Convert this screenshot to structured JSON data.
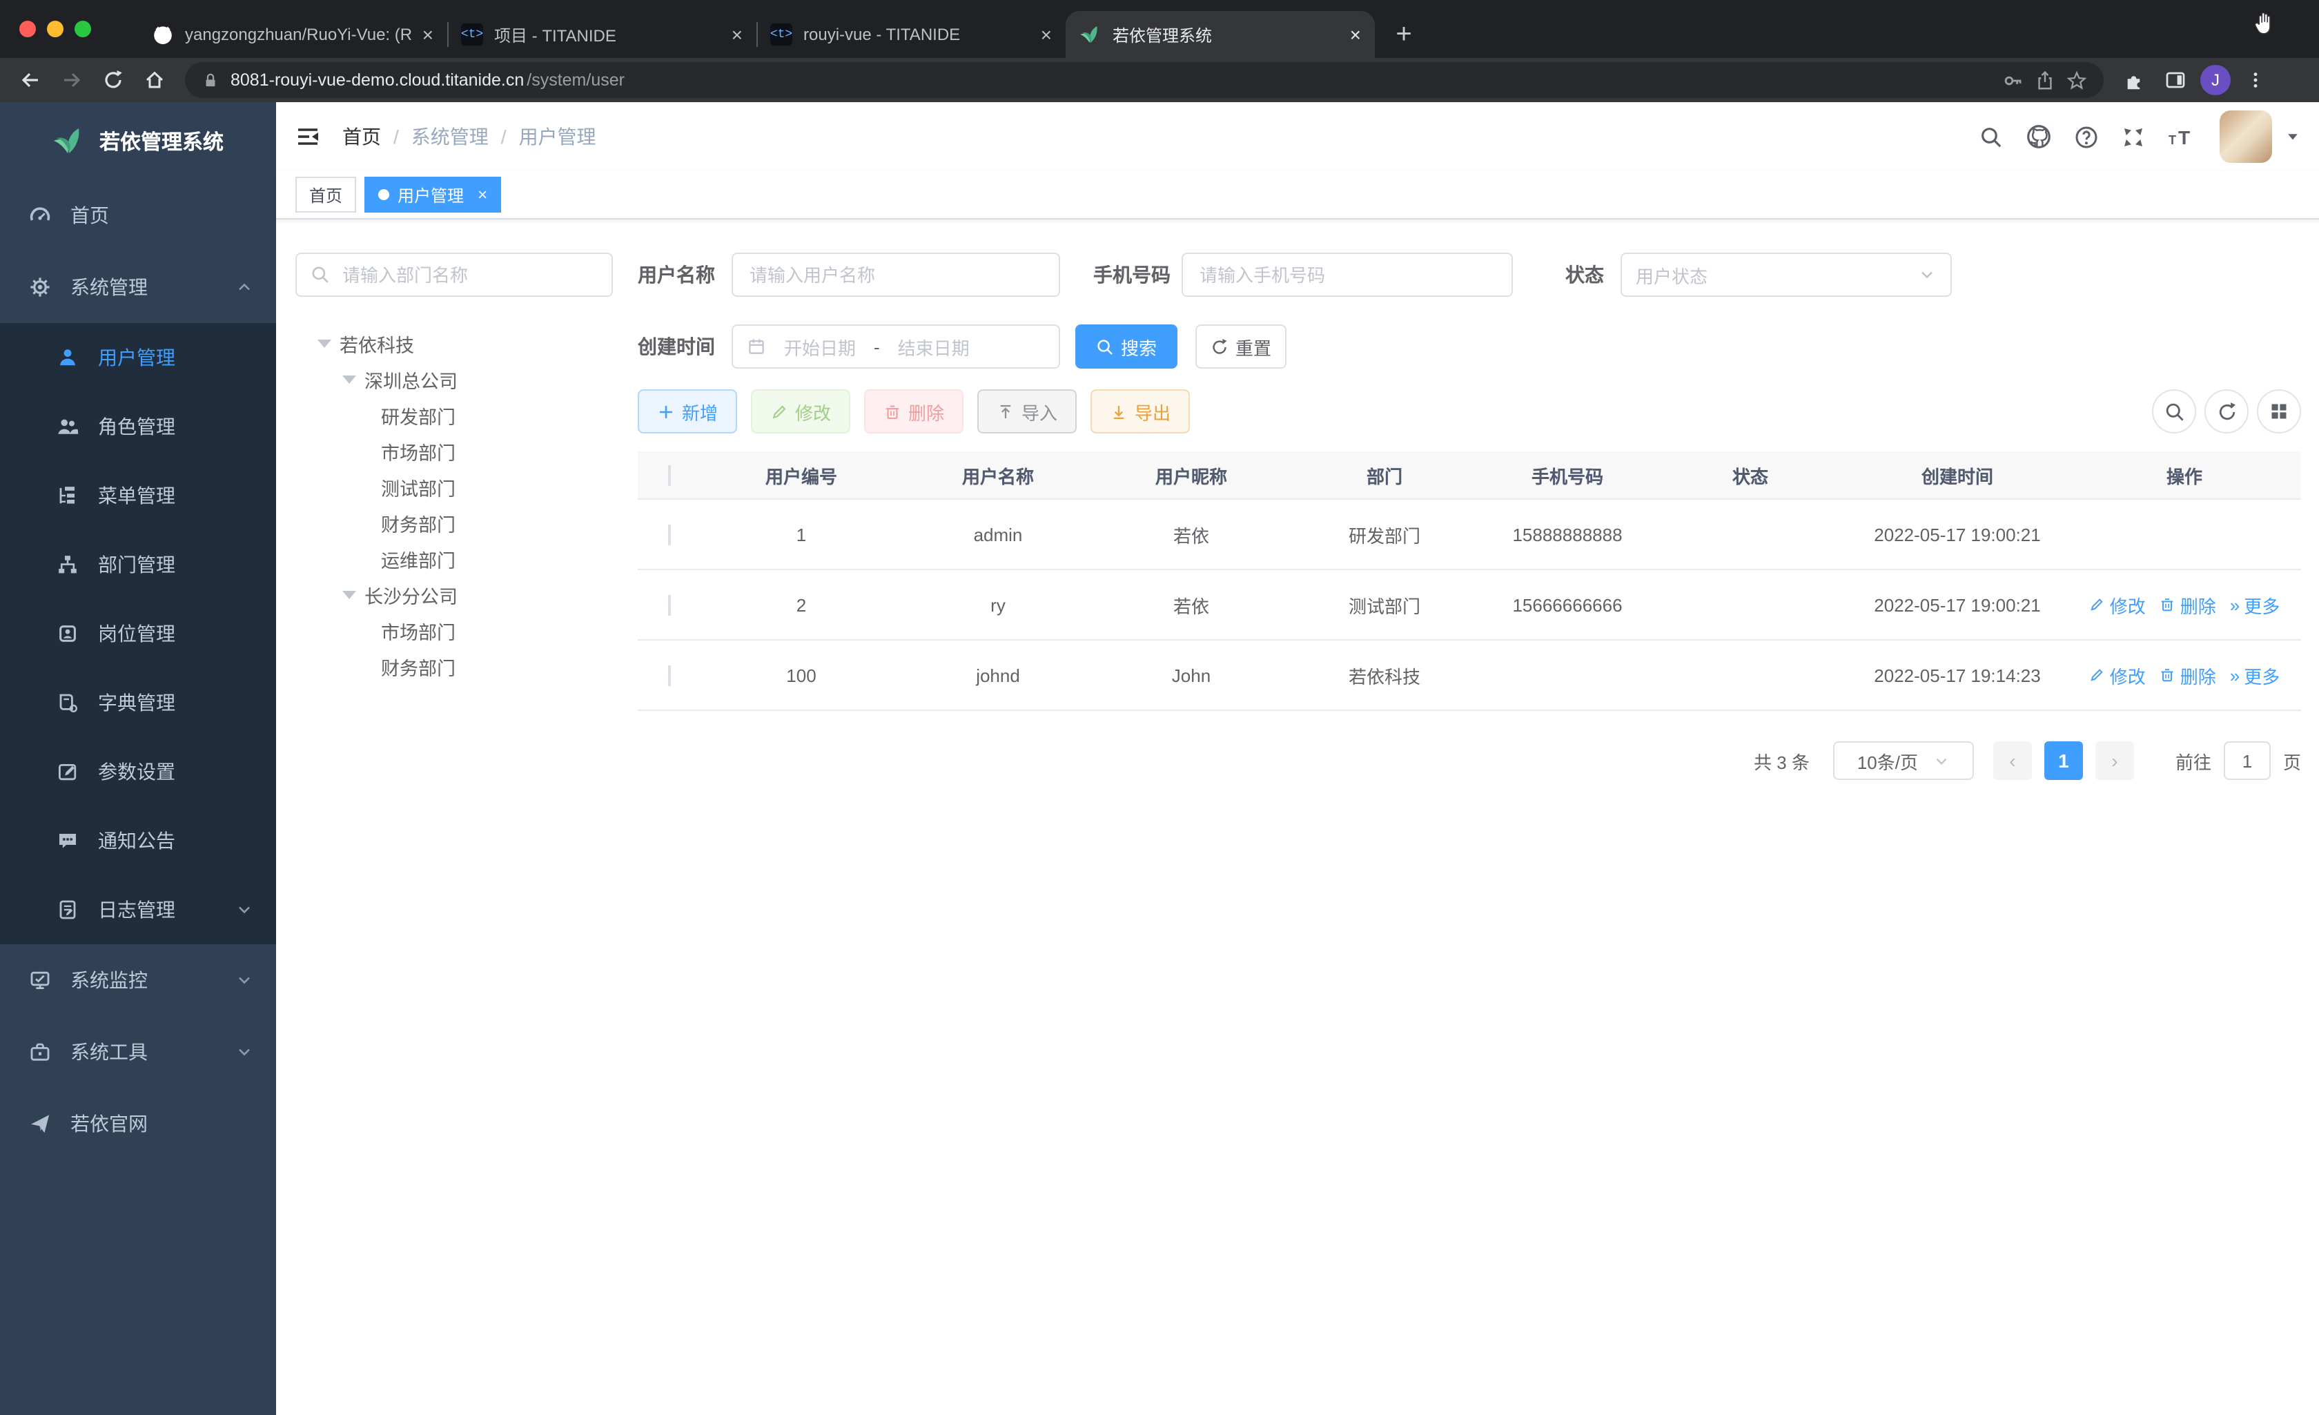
{
  "browser": {
    "tabs": [
      {
        "title": "yangzongzhuan/RuoYi-Vue: (Ru",
        "close": "×"
      },
      {
        "title": "项目 - TITANIDE",
        "close": "×",
        "favicon_text": "<t>"
      },
      {
        "title": "rouyi-vue - TITANIDE",
        "close": "×",
        "favicon_text": "<t>"
      },
      {
        "title": "若依管理系统",
        "close": "×"
      }
    ],
    "new_tab": "+",
    "url_host": "8081-rouyi-vue-demo.cloud.titanide.cn",
    "url_path": "/system/user",
    "profile_initial": "J"
  },
  "sidebar": {
    "logo_title": "若依管理系统",
    "menu": [
      {
        "label": "首页"
      },
      {
        "label": "系统管理"
      },
      {
        "label": "系统监控"
      },
      {
        "label": "系统工具"
      },
      {
        "label": "若依官网"
      }
    ],
    "submenu": [
      {
        "label": "用户管理"
      },
      {
        "label": "角色管理"
      },
      {
        "label": "菜单管理"
      },
      {
        "label": "部门管理"
      },
      {
        "label": "岗位管理"
      },
      {
        "label": "字典管理"
      },
      {
        "label": "参数设置"
      },
      {
        "label": "通知公告"
      },
      {
        "label": "日志管理"
      }
    ]
  },
  "navbar": {
    "breadcrumb": [
      "首页",
      "系统管理",
      "用户管理"
    ],
    "separator": "/"
  },
  "tags": {
    "home": "首页",
    "active": "用户管理",
    "close": "×"
  },
  "tree": {
    "search_placeholder": "请输入部门名称",
    "nodes": [
      {
        "label": "若依科技"
      },
      {
        "label": "深圳总公司"
      },
      {
        "label": "研发部门"
      },
      {
        "label": "市场部门"
      },
      {
        "label": "测试部门"
      },
      {
        "label": "财务部门"
      },
      {
        "label": "运维部门"
      },
      {
        "label": "长沙分公司"
      },
      {
        "label": "市场部门"
      },
      {
        "label": "财务部门"
      }
    ]
  },
  "filters": {
    "username_label": "用户名称",
    "username_placeholder": "请输入用户名称",
    "phone_label": "手机号码",
    "phone_placeholder": "请输入手机号码",
    "status_label": "状态",
    "status_placeholder": "用户状态",
    "created_label": "创建时间",
    "date_start_placeholder": "开始日期",
    "date_separator": "-",
    "date_end_placeholder": "结束日期",
    "search_label": "搜索",
    "reset_label": "重置"
  },
  "toolbar": {
    "add": "新增",
    "edit": "修改",
    "delete": "删除",
    "import": "导入",
    "export": "导出"
  },
  "table": {
    "columns": [
      "用户编号",
      "用户名称",
      "用户昵称",
      "部门",
      "手机号码",
      "状态",
      "创建时间",
      "操作"
    ],
    "rows": [
      {
        "id": "1",
        "username": "admin",
        "nickname": "若依",
        "dept": "研发部门",
        "phone": "15888888888",
        "created": "2022-05-17 19:00:21"
      },
      {
        "id": "2",
        "username": "ry",
        "nickname": "若依",
        "dept": "测试部门",
        "phone": "15666666666",
        "created": "2022-05-17 19:00:21"
      },
      {
        "id": "100",
        "username": "johnd",
        "nickname": "John",
        "dept": "若依科技",
        "phone": "",
        "created": "2022-05-17 19:14:23"
      }
    ],
    "actions": {
      "edit": "修改",
      "delete": "删除",
      "more": "更多",
      "more_icon": "»"
    }
  },
  "pagination": {
    "total": "共 3 条",
    "page_size": "10条/页",
    "prev": "‹",
    "page": "1",
    "next": "›",
    "goto_label": "前往",
    "goto_value": "1",
    "page_unit": "页"
  },
  "colors": {
    "accent": "#409eff",
    "sidebar": "#304156",
    "sidebar_sub": "#1f2d3d"
  }
}
